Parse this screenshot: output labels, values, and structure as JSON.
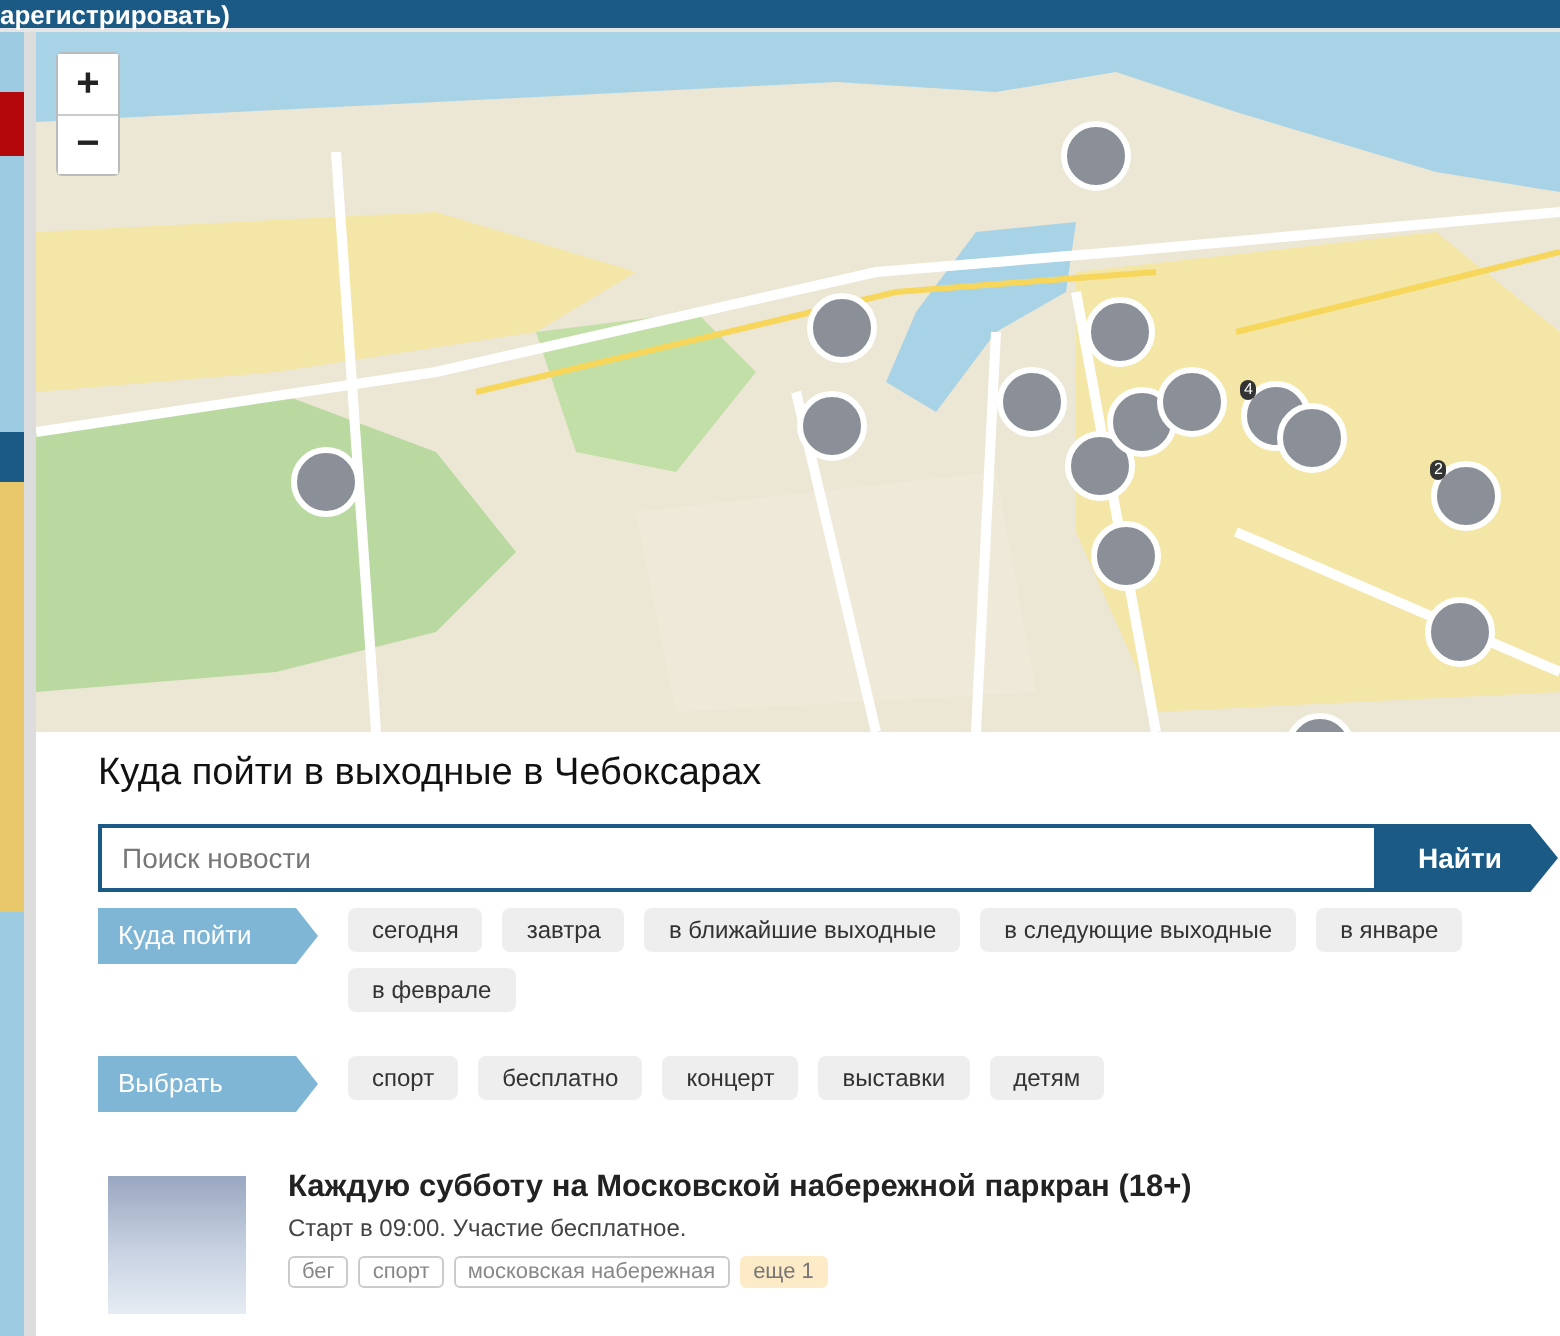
{
  "top_bar": {
    "text": "арегистрировать)"
  },
  "map": {
    "zoom_in": "+",
    "zoom_out": "−",
    "cluster_counts": [
      "4",
      "2"
    ]
  },
  "title": "Куда пойти в выходные в Чебоксарах",
  "search": {
    "placeholder": "Поиск новости",
    "button": "Найти"
  },
  "filters": [
    {
      "label": "Куда пойти",
      "chips": [
        "сегодня",
        "завтра",
        "в ближайшие выходные",
        "в следующие выходные",
        "в январе",
        "в феврале"
      ]
    },
    {
      "label": "Выбрать",
      "chips": [
        "спорт",
        "бесплатно",
        "концерт",
        "выставки",
        "детям"
      ]
    }
  ],
  "events": [
    {
      "title": "Каждую субботу на Московской набережной паркран (18+)",
      "description": "Старт в 09:00. Участие бесплатное.",
      "tags": [
        {
          "text": "бег",
          "kind": "tag"
        },
        {
          "text": "спорт",
          "kind": "tag"
        },
        {
          "text": "московская набережная",
          "kind": "tag"
        },
        {
          "text": "еще 1",
          "kind": "more"
        }
      ]
    }
  ]
}
